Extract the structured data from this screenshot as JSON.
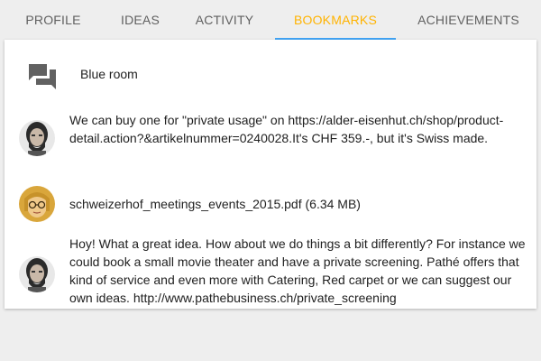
{
  "tabs": [
    {
      "label": "PROFILE"
    },
    {
      "label": "IDEAS"
    },
    {
      "label": "ACTIVITY"
    },
    {
      "label": "BOOKMARKS"
    },
    {
      "label": "ACHIEVEMENTS"
    }
  ],
  "active_tab": "BOOKMARKS",
  "colors": {
    "active_tab_text": "#ffb300",
    "active_tab_indicator": "#42a5f5",
    "background": "#eeeeee",
    "card": "#ffffff"
  },
  "bookmarks": [
    {
      "icon": "forum-icon",
      "text": "Blue room"
    },
    {
      "icon": "avatar-bearded-man",
      "text": "We can buy one for \"private usage\" on https://alder-eisenhut.ch/shop/product-detail.action?&artikelnummer=0240028.It's CHF 359.-, but it's Swiss made."
    },
    {
      "icon": "avatar-woman-glasses",
      "text": "schweizerhof_meetings_events_2015.pdf (6.34 MB)"
    },
    {
      "icon": "avatar-bearded-man",
      "text": "Hoy! What a great idea. How about we do things a bit differently? For instance we could book a small movie theater and have a private screening. Pathé offers that kind of service and even more with Catering, Red carpet or we can suggest our own ideas. http://www.pathebusiness.ch/private_screening"
    }
  ]
}
